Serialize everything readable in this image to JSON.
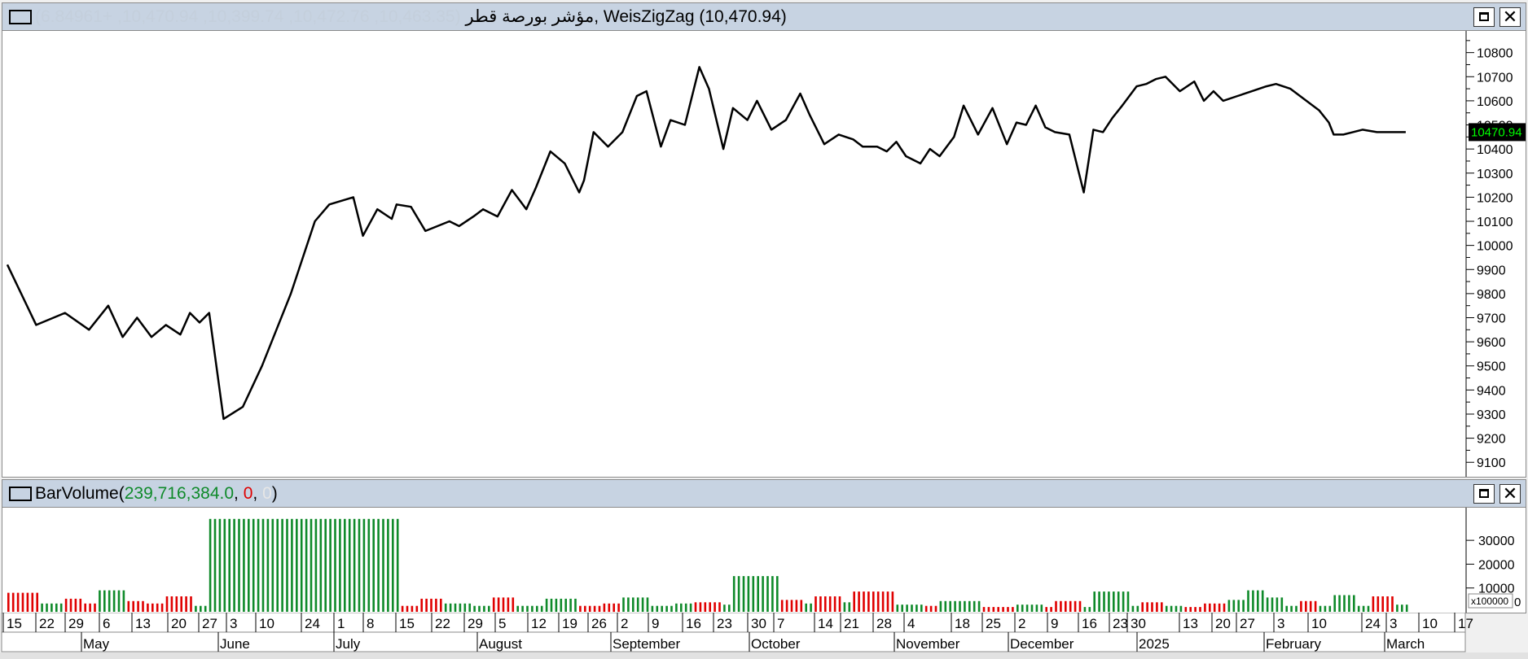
{
  "price_pane": {
    "symbol": "مؤشر بورصة قطر",
    "ohlc_readout": "(10,463.35, 10,472.76, 10,399.74, 10,470.94, +6.84961)",
    "indicator_name": "WeisZigZag",
    "indicator_readout": "(10,470.94)",
    "last_value_label": "10470.94",
    "maximize_label": "□",
    "close_label": "✕"
  },
  "volume_pane": {
    "title": "BarVolume",
    "readout_open": "(",
    "readout_value": "239,716,384.0",
    "readout_sep1": ", ",
    "readout_red": "0",
    "readout_sep2": ", ",
    "readout_faint": "0",
    "readout_close": ")",
    "scale_label": "x100000",
    "maximize_label": "□",
    "close_label": "✕"
  },
  "time_axis": {
    "day_labels": [
      "15",
      "22",
      "29",
      "6",
      "13",
      "20",
      "27",
      "3",
      "10",
      "24",
      "1",
      "8",
      "15",
      "22",
      "29",
      "5",
      "12",
      "19",
      "26",
      "2",
      "9",
      "16",
      "23",
      "30",
      "7",
      "14",
      "21",
      "28",
      "4",
      "18",
      "25",
      "2",
      "9",
      "16",
      "23",
      "30",
      "13",
      "20",
      "27",
      "3",
      "10",
      "24",
      "3",
      "10",
      "17"
    ],
    "month_labels": [
      "May",
      "June",
      "July",
      "August",
      "September",
      "October",
      "November",
      "December",
      "2025",
      "February",
      "March"
    ]
  },
  "chart_data": [
    {
      "type": "line",
      "name": "WeisZigZag",
      "y_ticks": [
        9100,
        9200,
        9300,
        9400,
        9500,
        9600,
        9700,
        9800,
        9900,
        10000,
        10100,
        10200,
        10300,
        10400,
        10500,
        10600,
        10700,
        10800
      ],
      "ylim": [
        9040,
        10890
      ],
      "x": [
        0,
        6,
        12,
        17,
        21,
        24,
        27,
        30,
        33,
        36,
        38,
        40,
        42,
        45,
        49,
        53,
        59,
        64,
        67,
        72,
        74,
        77,
        80,
        81,
        84,
        87,
        92,
        94,
        97,
        99,
        102,
        105,
        108,
        110,
        113,
        116,
        119,
        120,
        122,
        125,
        128,
        131,
        133,
        136,
        138,
        141,
        144,
        146,
        149,
        151,
        154,
        156,
        159,
        162,
        165,
        167,
        170,
        173,
        176,
        178,
        181,
        183,
        185,
        187,
        190,
        192,
        194,
        197,
        199,
        202,
        205,
        208,
        210,
        212,
        214,
        216,
        218,
        221,
        224,
        226,
        228,
        230,
        232,
        235,
        237,
        239,
        241,
        244,
        247,
        249,
        251,
        253,
        256,
        259,
        262,
        264,
        267,
        269,
        271,
        273,
        275,
        276,
        278,
        280,
        282,
        285,
        287,
        289,
        291
      ],
      "y": [
        9920,
        9670,
        9720,
        9650,
        9750,
        9620,
        9700,
        9620,
        9670,
        9630,
        9720,
        9680,
        9720,
        9280,
        9330,
        9500,
        9800,
        10100,
        10170,
        10200,
        10040,
        10150,
        10110,
        10170,
        10160,
        10060,
        10100,
        10080,
        10120,
        10150,
        10120,
        10230,
        10150,
        10240,
        10390,
        10340,
        10220,
        10270,
        10470,
        10410,
        10470,
        10620,
        10640,
        10410,
        10520,
        10500,
        10740,
        10650,
        10400,
        10570,
        10520,
        10600,
        10480,
        10520,
        10630,
        10540,
        10420,
        10460,
        10440,
        10410,
        10410,
        10390,
        10430,
        10370,
        10340,
        10400,
        10370,
        10450,
        10580,
        10460,
        10570,
        10420,
        10510,
        10500,
        10580,
        10490,
        10470,
        10460,
        10220,
        10480,
        10470,
        10530,
        10580,
        10660,
        10670,
        10690,
        10700,
        10640,
        10680,
        10600,
        10640,
        10600,
        10620,
        10640,
        10660,
        10670,
        10650,
        10620,
        10590,
        10560,
        10510,
        10460,
        10460,
        10470,
        10480,
        10470,
        10470,
        10470,
        10470
      ]
    },
    {
      "type": "bar",
      "name": "BarVolume",
      "y_ticks_label": "x100000",
      "y_ticks": [
        10000,
        20000,
        30000
      ],
      "ylim": [
        0,
        42000
      ],
      "values": [
        2397,
        0,
        0
      ],
      "segments": [
        {
          "start": 0,
          "count": 7,
          "value": 8000,
          "color": "red"
        },
        {
          "start": 7,
          "count": 5,
          "value": 3500,
          "color": "green"
        },
        {
          "start": 12,
          "count": 4,
          "value": 5500,
          "color": "red"
        },
        {
          "start": 16,
          "count": 3,
          "value": 3500,
          "color": "red"
        },
        {
          "start": 19,
          "count": 6,
          "value": 9000,
          "color": "green"
        },
        {
          "start": 25,
          "count": 4,
          "value": 4500,
          "color": "red"
        },
        {
          "start": 29,
          "count": 4,
          "value": 3500,
          "color": "red"
        },
        {
          "start": 33,
          "count": 6,
          "value": 6500,
          "color": "red"
        },
        {
          "start": 39,
          "count": 3,
          "value": 2500,
          "color": "green"
        },
        {
          "start": 42,
          "count": 40,
          "value": 39000,
          "color": "green"
        },
        {
          "start": 82,
          "count": 4,
          "value": 2500,
          "color": "red"
        },
        {
          "start": 86,
          "count": 5,
          "value": 5500,
          "color": "red"
        },
        {
          "start": 91,
          "count": 6,
          "value": 3500,
          "color": "green"
        },
        {
          "start": 97,
          "count": 4,
          "value": 2500,
          "color": "green"
        },
        {
          "start": 101,
          "count": 5,
          "value": 6000,
          "color": "red"
        },
        {
          "start": 106,
          "count": 6,
          "value": 2500,
          "color": "green"
        },
        {
          "start": 112,
          "count": 7,
          "value": 5500,
          "color": "green"
        },
        {
          "start": 119,
          "count": 5,
          "value": 2500,
          "color": "red"
        },
        {
          "start": 124,
          "count": 4,
          "value": 3500,
          "color": "red"
        },
        {
          "start": 128,
          "count": 6,
          "value": 6000,
          "color": "green"
        },
        {
          "start": 134,
          "count": 5,
          "value": 2500,
          "color": "green"
        },
        {
          "start": 139,
          "count": 4,
          "value": 3500,
          "color": "green"
        },
        {
          "start": 143,
          "count": 6,
          "value": 4000,
          "color": "red"
        },
        {
          "start": 149,
          "count": 2,
          "value": 3000,
          "color": "green"
        },
        {
          "start": 151,
          "count": 10,
          "value": 15000,
          "color": "green"
        },
        {
          "start": 161,
          "count": 5,
          "value": 5000,
          "color": "red"
        },
        {
          "start": 166,
          "count": 2,
          "value": 3500,
          "color": "green"
        },
        {
          "start": 168,
          "count": 6,
          "value": 6500,
          "color": "red"
        },
        {
          "start": 174,
          "count": 2,
          "value": 4000,
          "color": "green"
        },
        {
          "start": 176,
          "count": 9,
          "value": 8500,
          "color": "red"
        },
        {
          "start": 185,
          "count": 6,
          "value": 3000,
          "color": "green"
        },
        {
          "start": 191,
          "count": 3,
          "value": 2500,
          "color": "red"
        },
        {
          "start": 194,
          "count": 9,
          "value": 4500,
          "color": "green"
        },
        {
          "start": 203,
          "count": 7,
          "value": 2000,
          "color": "red"
        },
        {
          "start": 210,
          "count": 6,
          "value": 3000,
          "color": "green"
        },
        {
          "start": 216,
          "count": 2,
          "value": 2000,
          "color": "red"
        },
        {
          "start": 218,
          "count": 6,
          "value": 4500,
          "color": "red"
        },
        {
          "start": 224,
          "count": 2,
          "value": 2000,
          "color": "green"
        },
        {
          "start": 226,
          "count": 8,
          "value": 8500,
          "color": "green"
        },
        {
          "start": 234,
          "count": 2,
          "value": 2500,
          "color": "green"
        },
        {
          "start": 236,
          "count": 5,
          "value": 4000,
          "color": "red"
        },
        {
          "start": 241,
          "count": 4,
          "value": 2500,
          "color": "green"
        },
        {
          "start": 245,
          "count": 4,
          "value": 2000,
          "color": "red"
        },
        {
          "start": 249,
          "count": 5,
          "value": 3500,
          "color": "red"
        },
        {
          "start": 254,
          "count": 4,
          "value": 5000,
          "color": "green"
        },
        {
          "start": 258,
          "count": 4,
          "value": 9000,
          "color": "green"
        },
        {
          "start": 262,
          "count": 4,
          "value": 6000,
          "color": "green"
        },
        {
          "start": 266,
          "count": 3,
          "value": 2500,
          "color": "green"
        },
        {
          "start": 269,
          "count": 4,
          "value": 4500,
          "color": "red"
        },
        {
          "start": 273,
          "count": 3,
          "value": 2500,
          "color": "green"
        },
        {
          "start": 276,
          "count": 5,
          "value": 7000,
          "color": "green"
        },
        {
          "start": 281,
          "count": 3,
          "value": 2500,
          "color": "green"
        },
        {
          "start": 284,
          "count": 5,
          "value": 6500,
          "color": "red"
        },
        {
          "start": 289,
          "count": 3,
          "value": 3000,
          "color": "green"
        }
      ]
    }
  ],
  "colors": {
    "title_bar": "#c7d3e2",
    "up_volume": "#0f8a2a",
    "down_volume": "#e00000",
    "line": "#000000",
    "last_value_bg": "#000000",
    "last_value_fg": "#00ff00"
  }
}
